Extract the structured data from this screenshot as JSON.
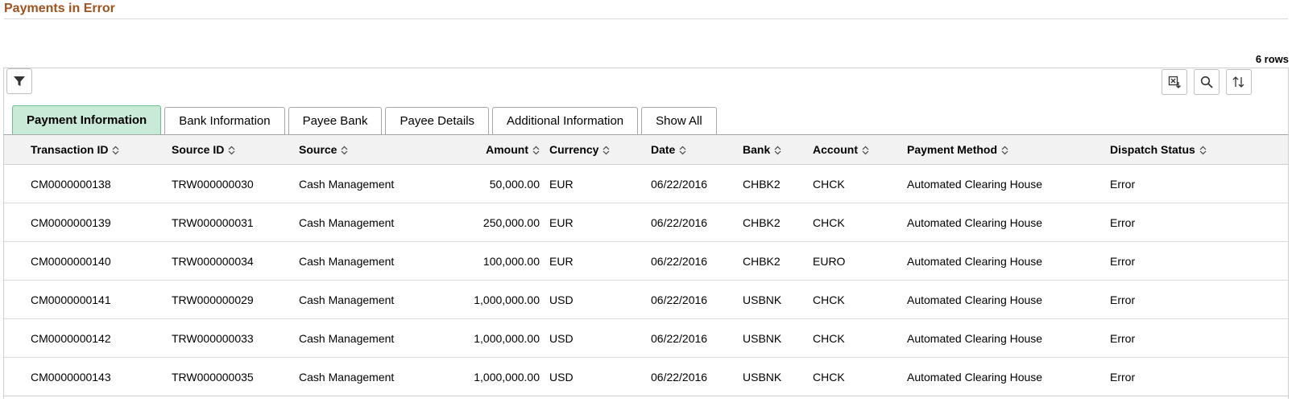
{
  "page_title": "Payments in Error",
  "row_count": "6 rows",
  "toolbar": {
    "filter_icon": "filter-icon",
    "export_icon": "export-excel-icon",
    "search_icon": "search-icon",
    "sort_icon": "sort-icon"
  },
  "tabs": [
    {
      "label": "Payment Information",
      "active": true
    },
    {
      "label": "Bank Information",
      "active": false
    },
    {
      "label": "Payee Bank",
      "active": false
    },
    {
      "label": "Payee Details",
      "active": false
    },
    {
      "label": "Additional Information",
      "active": false
    },
    {
      "label": "Show All",
      "active": false
    }
  ],
  "columns": [
    "Transaction ID",
    "Source ID",
    "Source",
    "Amount",
    "Currency",
    "Date",
    "Bank",
    "Account",
    "Payment Method",
    "Dispatch Status"
  ],
  "rows": [
    [
      "CM0000000138",
      "TRW000000030",
      "Cash Management",
      "50,000.00",
      "EUR",
      "06/22/2016",
      "CHBK2",
      "CHCK",
      "Automated Clearing House",
      "Error"
    ],
    [
      "CM0000000139",
      "TRW000000031",
      "Cash Management",
      "250,000.00",
      "EUR",
      "06/22/2016",
      "CHBK2",
      "CHCK",
      "Automated Clearing House",
      "Error"
    ],
    [
      "CM0000000140",
      "TRW000000034",
      "Cash Management",
      "100,000.00",
      "EUR",
      "06/22/2016",
      "CHBK2",
      "EURO",
      "Automated Clearing House",
      "Error"
    ],
    [
      "CM0000000141",
      "TRW000000029",
      "Cash Management",
      "1,000,000.00",
      "USD",
      "06/22/2016",
      "USBNK",
      "CHCK",
      "Automated Clearing House",
      "Error"
    ],
    [
      "CM0000000142",
      "TRW000000033",
      "Cash Management",
      "1,000,000.00",
      "USD",
      "06/22/2016",
      "USBNK",
      "CHCK",
      "Automated Clearing House",
      "Error"
    ],
    [
      "CM0000000143",
      "TRW000000035",
      "Cash Management",
      "1,000,000.00",
      "USD",
      "06/22/2016",
      "USBNK",
      "CHCK",
      "Automated Clearing House",
      "Error"
    ]
  ],
  "colors": {
    "title": "#a0521c",
    "active_tab_bg": "#c8ead6",
    "active_tab_border": "#6fbf8c",
    "header_bg": "#f2f2f2"
  }
}
